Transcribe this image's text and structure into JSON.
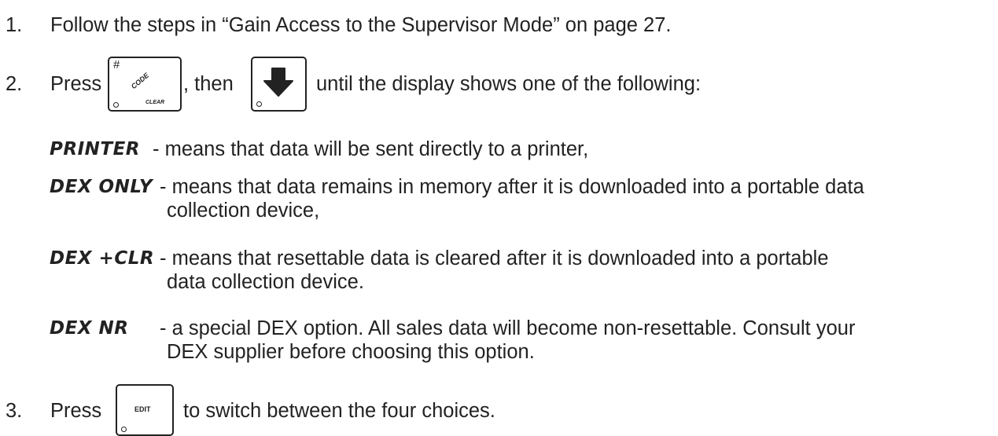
{
  "steps": [
    {
      "number": "1.",
      "text": "Follow the steps in “Gain Access to the Supervisor Mode” on page 27."
    },
    {
      "number": "2.",
      "press": "Press",
      "mid": ", then",
      "after": "until the display shows one of the following:"
    },
    {
      "number": "3.",
      "press": "Press",
      "after": "to switch between the four choices."
    }
  ],
  "keys": {
    "code_key": {
      "hash": "#",
      "code": "CODE",
      "clear": "CLEAR"
    },
    "edit_key": {
      "label": "EDIT"
    }
  },
  "options": [
    {
      "display": "PRINTER",
      "line1": "-  means that data will be sent directly to a printer,"
    },
    {
      "display": "DEX ONLY",
      "line1": "- means that data remains in memory after it is downloaded into a portable data",
      "line2": "collection device,"
    },
    {
      "display": "DEX +CLR",
      "line1": "- means that resettable data is cleared after it is downloaded into a portable",
      "line2": "data collection device."
    },
    {
      "display": "DEX NR",
      "line1": "- a special DEX option. All sales data will become non-resettable. Consult your",
      "line2": "DEX supplier before choosing this option."
    }
  ]
}
